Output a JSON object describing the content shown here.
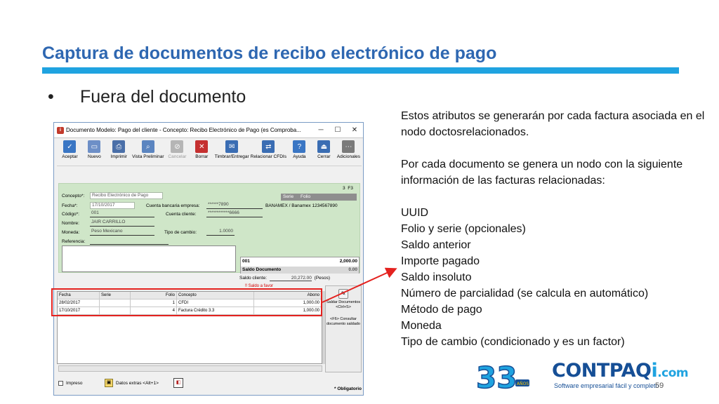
{
  "slide": {
    "title": "Captura de documentos de recibo electrónico de pago",
    "bullet_symbol": "•",
    "bullet": "Fuera del documento",
    "page_number": "59"
  },
  "notes": {
    "para1": "Estos atributos se generarán por cada factura asociada en el nodo doctosrelacionados.",
    "para2": "Por cada documento se genera un nodo con la siguiente información de las facturas relacionadas:",
    "items": [
      "UUID",
      "Folio y serie (opcionales)",
      "Saldo anterior",
      "Importe pagado",
      "Saldo insoluto",
      "Número de parcialidad (se calcula en automático)",
      "Método de pago",
      "Moneda",
      "Tipo de cambio (condicionado y es un factor)"
    ]
  },
  "window": {
    "title": "Documento Modelo: Pago del cliente - Concepto: Recibo Electrónico de Pago (es Comproba...",
    "app_icon": "i",
    "controls": [
      "─",
      "☐",
      "✕"
    ]
  },
  "toolbar": {
    "buttons": [
      {
        "label": "Aceptar",
        "icon": "check-icon",
        "glyph": "✓",
        "color": "#3a76c4"
      },
      {
        "label": "Nuevo",
        "icon": "new-document-icon",
        "glyph": "▭",
        "color": "#6d8fc7"
      },
      {
        "label": "Imprimir",
        "icon": "printer-icon",
        "glyph": "⎙",
        "color": "#4a6fa8"
      },
      {
        "label": "Vista Preliminar",
        "icon": "preview-icon",
        "glyph": "⌕",
        "color": "#5b85c0"
      },
      {
        "label": "Cancelar",
        "icon": "cancel-icon",
        "glyph": "⊘",
        "color": "#b5b5b5"
      },
      {
        "label": "Borrar",
        "icon": "delete-icon",
        "glyph": "✕",
        "color": "#c53030"
      },
      {
        "label": "Timbrar/Entregar",
        "icon": "stamp-icon",
        "glyph": "✉",
        "color": "#3a6db3"
      },
      {
        "label": "Relacionar CFDIs",
        "icon": "link-cfdi-icon",
        "glyph": "⇄",
        "color": "#3a6db3"
      },
      {
        "label": "Ayuda",
        "icon": "help-icon",
        "glyph": "?",
        "color": "#3a76c4"
      },
      {
        "label": "Cerrar",
        "icon": "exit-icon",
        "glyph": "⏏",
        "color": "#3a6db3"
      },
      {
        "label": "Adicionales",
        "icon": "more-icon",
        "glyph": "⋯",
        "color": "#7a7a7a"
      }
    ]
  },
  "form": {
    "concepto_label": "Concepto*:",
    "concepto_value": "Recibo Electrónico de Pago",
    "serie_label": "Serie",
    "folio_label": "Folio",
    "folio_number": "3",
    "folio_key": "F3",
    "fecha_label": "Fecha*:",
    "fecha_value": "17/10/2017",
    "cuenta_empresa_label": "Cuenta bancaria empresa:",
    "cuenta_empresa_value": "******7890",
    "banco_value": "BANAMEX / Banamex 1234567890",
    "codigo_label": "Código*:",
    "codigo_value": "001",
    "cuenta_cliente_label": "Cuenta cliente:",
    "cuenta_cliente_value": "************6666",
    "nombre_label": "Nombre:",
    "nombre_value": "JAIR CARRILLO",
    "moneda_label": "Moneda:",
    "moneda_value": "Peso Mexicano",
    "tipo_cambio_label": "Tipo de cambio:",
    "tipo_cambio_value": "1.0000",
    "referencia_label": "Referencia:",
    "total_row_code": "001",
    "total_row_amount": "2,000.00",
    "saldo_documento_label": "Saldo Documento",
    "saldo_documento_value": "0.00",
    "saldo_cliente_label": "Saldo cliente:",
    "saldo_cliente_value": "20,272.00",
    "saldo_cliente_currency": "(Pesos)",
    "error_marker": "‼ Saldo a favor"
  },
  "grid": {
    "headers": [
      "Fecha",
      "Serie",
      "Folio",
      "Concepto",
      "Abono"
    ],
    "rows": [
      [
        "28/02/2017",
        "",
        "1",
        "CFDI",
        "1,000.00"
      ],
      [
        "17/10/2017",
        "",
        "4",
        "Factura Crédito 3.3",
        "1,000.00"
      ]
    ]
  },
  "side_panel": {
    "saldar_label": "Saldar Documentos <Ctrl+S>",
    "consultar_label": "<F6> Consultar documento saldado"
  },
  "statusbar": {
    "impreso": "Impreso",
    "datos_extras": "Datos extras <Alt+1>",
    "obligatorio": "* Obligatorio"
  },
  "branding": {
    "logo_number": "33",
    "logo_sub": "AÑOS",
    "brand_main": "CONTPAQ",
    "brand_i": "i",
    "brand_com": ".com",
    "tagline": "Software empresarial fácil y completo"
  },
  "colors": {
    "title_blue": "#2e67b1",
    "accent_cyan": "#1fa3e0",
    "highlight_red": "#e4221f"
  }
}
